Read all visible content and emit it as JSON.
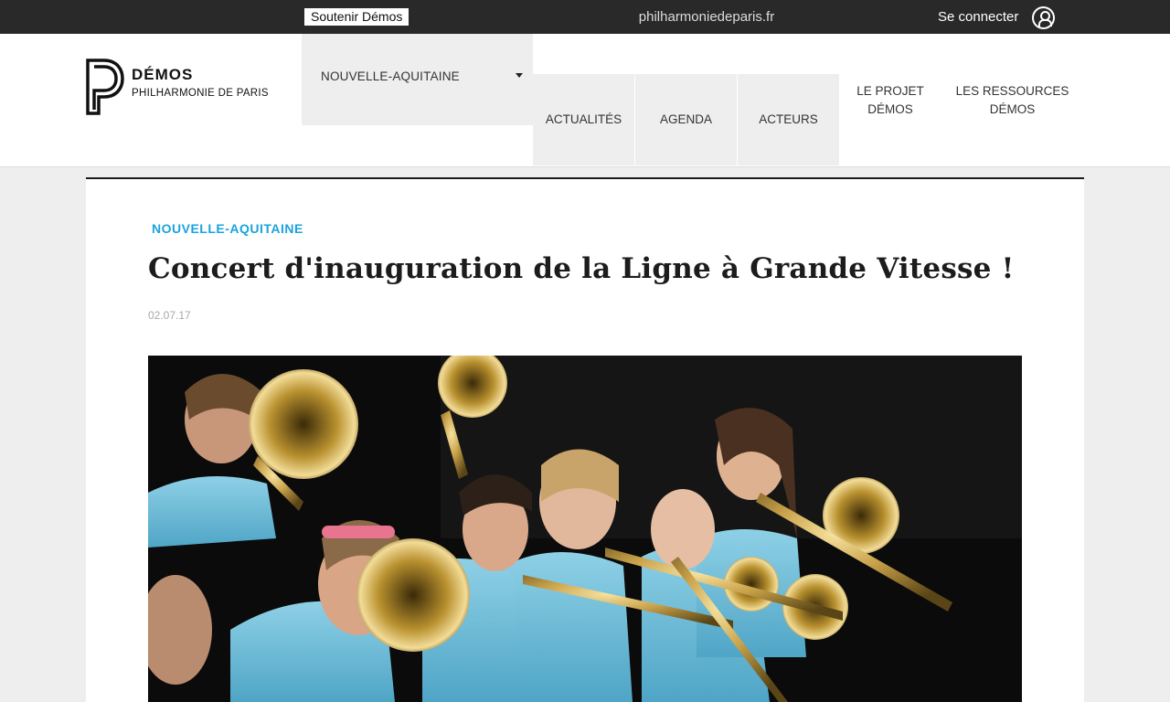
{
  "topbar": {
    "support_label": "Soutenir Démos",
    "site_link": "philharmoniedeparis.fr",
    "login_label": "Se connecter",
    "login_icon": "user-circle-icon"
  },
  "logo": {
    "title": "DÉMOS",
    "subtitle": "PHILHARMONIE DE PARIS"
  },
  "region_select": {
    "selected": "NOUVELLE-AQUITAINE",
    "icon": "caret-down-icon"
  },
  "nav": {
    "items": [
      {
        "label": "ACTUALITÉS"
      },
      {
        "label": "AGENDA"
      },
      {
        "label": "ACTEURS"
      },
      {
        "label": "LE PROJET DÉMOS"
      },
      {
        "label": "LES RESSOURCES DÉMOS"
      }
    ]
  },
  "article": {
    "category": "NOUVELLE-AQUITAINE",
    "title": "Concert d'inauguration de la Ligne à Grande Vitesse !",
    "date": "02.07.17",
    "image_subject": "young brass musicians playing trumpets and trombones"
  },
  "colors": {
    "topbar_bg": "#292929",
    "accent": "#1aa3de",
    "nav_gray": "#eeeeee",
    "page_bg": "#eeeeee"
  }
}
